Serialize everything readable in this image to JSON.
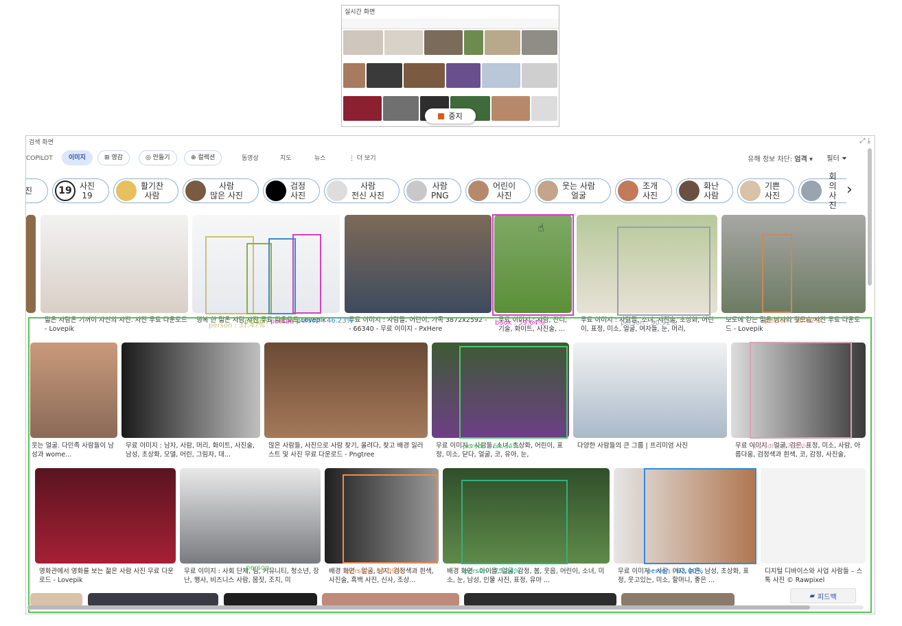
{
  "preview": {
    "title": "실시간 화면",
    "stop_label": "중지"
  },
  "window": {
    "label": "검색 화면",
    "expand_icon": "expand-icon",
    "download_icon": "download-icon"
  },
  "nav": {
    "tabs": [
      {
        "label": "COPILOT",
        "style": "plain"
      },
      {
        "label": "이미지",
        "style": "active"
      },
      {
        "label": "영감",
        "style": "pill"
      },
      {
        "label": "만들기",
        "style": "pill"
      },
      {
        "label": "컬렉션",
        "style": "pill"
      },
      {
        "label": "동영상",
        "style": "plain"
      },
      {
        "label": "지도",
        "style": "plain"
      },
      {
        "label": "뉴스",
        "style": "plain"
      },
      {
        "label": "⋮ 더 보기",
        "style": "plain"
      }
    ],
    "safe_search_label": "유해 정보 차단:",
    "safe_search_value": "엄격",
    "filter_label": "필터"
  },
  "chips": [
    {
      "line1": "사진",
      "line2": "19",
      "badge": "19"
    },
    {
      "line1": "활기찬",
      "line2": "사람"
    },
    {
      "line1": "사람",
      "line2": "많은 사진"
    },
    {
      "line1": "검정",
      "line2": "사진"
    },
    {
      "line1": "사람",
      "line2": "전신 사진"
    },
    {
      "line1": "사람",
      "line2": "PNG"
    },
    {
      "line1": "어린이",
      "line2": "사진"
    },
    {
      "line1": "웃는 사람",
      "line2": "얼굴"
    },
    {
      "line1": "조개",
      "line2": "사진"
    },
    {
      "line1": "화난",
      "line2": "사람"
    },
    {
      "line1": "기쁜",
      "line2": "사진"
    },
    {
      "line1": "회의",
      "line2": "사진"
    }
  ],
  "captions": {
    "r1": [
      "젊은 사람은 기꺼이 자신의 사진. 사진 무료 다운로드 - Lovepik",
      "행복 한 젊은 사람 사진 무료 다운로드 Lovepik",
      "무료 이미지 : 사람들, 어린이, 가족 3872x2592 - - 66340 - 무료 이미지 - PxHere",
      "무료 이미지 : 사람, 잔디, 기술, 화이트, 사진술, ...",
      "무료 이미지 : 사람들, 소녀, 사진술, 초상화, 어린이, 표정, 미소, 얼굴, 여자들, 눈, 머리,",
      "보도에 걷는 젊은 남자의 뒷모습 사진 무료 다운로드 - Lovepik"
    ],
    "r2": [
      "웃는 얼굴. 다민족 사람들이 남성과 wome...",
      "무료 이미지 : 남자, 사람, 머리, 화이트, 사진술, 남성, 초상화, 모델, 어린, 그림자, 대...",
      "많은 사람들, 사진으로 사람 찾기, 올려다, 찾고 배경 일러스트 및 사진 무료 다운로드 - Pngtree",
      "무료 이미지 : 사람들, 소녀, 초상화, 어린이, 표정, 미소, 닫다, 얼굴, 코, 유아, 눈,",
      "다양한 사람들의 큰 그룹 | 프리미엄 사진",
      "무료 이미지 : 얼굴, 검은, 표정, 미소, 사람, 아름다움, 검정색과 흰색, 코, 감정, 사진술,"
    ],
    "r3": [
      "영화관에서 영화를 보는 젊은 사람 사진 무료 다운로드 - Lovepik",
      "무료 이미지 : 사회 단체, 팀, 커뮤니티, 청소년, 장난, 행사, 비즈니스 사람, 몸짓, 조치, 미",
      "배경 화면 : 얼굴, 남자, 검정색과 흰색, 사진술, 흑백 사진, 신사, 조상...",
      "배경 화면 : 아이들, 얼굴, 감정, 봄, 웃음, 어린이, 소녀, 미소, 눈, 남성, 인물 사진, 표정, 유아 ...",
      "무료 이미지 : 사람, 여자, 늙은, 남성, 초상화, 표정, 웃고있는, 미소, 할머니, 좋은 ...",
      "디지털 디바이스와 사업 사람들 – 스톡 사진 © Rawpixel"
    ]
  },
  "detections": [
    {
      "label": "person : 37.47%",
      "color": "#c9c07a"
    },
    {
      "label": "person : 59.29%",
      "color": "#8fae3c"
    },
    {
      "label": "person : 46.23%",
      "color": "#3b87d8"
    },
    {
      "label": "person",
      "color": "#d63fbf"
    },
    {
      "label": "book : 59.64%",
      "color": "#d83ad0"
    },
    {
      "label": "person : 50.92%",
      "color": "#9aa0a6"
    },
    {
      "label": "person : 50.62%",
      "color": "#c98a5a"
    },
    {
      "label": "person",
      "color": "#58c15a"
    },
    {
      "label": "person : 64.34%",
      "color": "#4cc66b"
    },
    {
      "label": "person : 57.38%",
      "color": "#d9a1b6"
    },
    {
      "label": "person : 84.09%",
      "color": "#f08a4b"
    },
    {
      "label": "person : 75.34%",
      "color": "#2fb27d"
    },
    {
      "label": "person : 63.60%",
      "color": "#2f8be0"
    }
  ],
  "feedback_label": "피드백"
}
